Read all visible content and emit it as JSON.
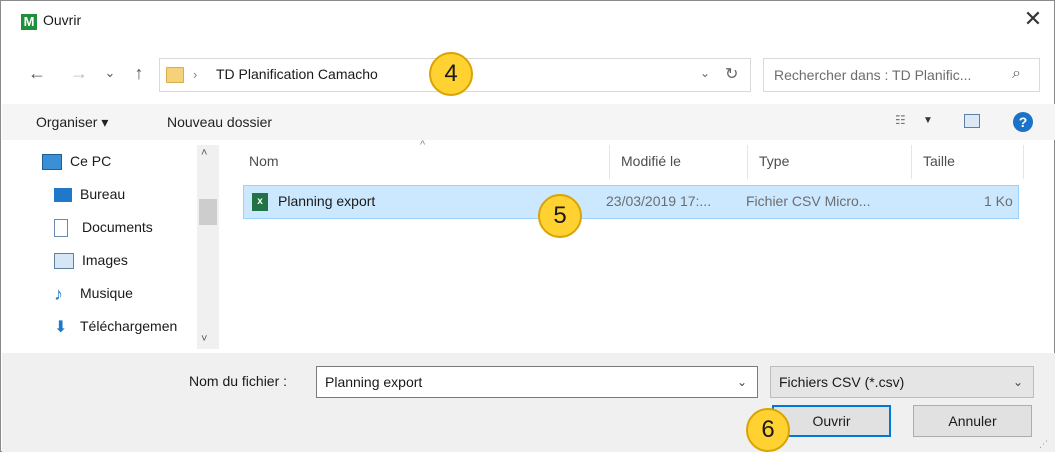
{
  "window": {
    "title": "Ouvrir",
    "app_icon_letter": "M",
    "close_glyph": "✕"
  },
  "nav": {
    "back": "←",
    "forward": "→",
    "recent": "⌄",
    "up": "↑"
  },
  "address": {
    "separator": "›",
    "path": "TD Planification Camacho",
    "dropdown": "⌄",
    "refresh": "↻"
  },
  "search": {
    "placeholder": "Rechercher dans : TD Planific...",
    "icon": "⌕"
  },
  "toolbar": {
    "organize": "Organiser ▾",
    "new_folder": "Nouveau dossier",
    "view_icon": "☷",
    "view_dropdown": "▼",
    "help": "?"
  },
  "sidebar": {
    "items": [
      {
        "label": "Ce PC",
        "icon": "pc-icon"
      },
      {
        "label": "Bureau",
        "icon": "desktop-icon"
      },
      {
        "label": "Documents",
        "icon": "documents-icon"
      },
      {
        "label": "Images",
        "icon": "images-icon"
      },
      {
        "label": "Musique",
        "icon": "music-icon"
      },
      {
        "label": "Téléchargemen",
        "icon": "download-icon"
      }
    ],
    "scroll_up": "˄",
    "scroll_down": "˅"
  },
  "columns": {
    "name": "Nom",
    "modified": "Modifié le",
    "type": "Type",
    "size": "Taille",
    "sort": "^"
  },
  "files": [
    {
      "name": "Planning export",
      "modified": "23/03/2019 17:...",
      "type": "Fichier CSV Micro...",
      "size": "1 Ko",
      "icon_letter": "x"
    }
  ],
  "footer": {
    "filename_label": "Nom du fichier :",
    "filename_value": "Planning export",
    "filename_dropdown": "⌄",
    "filter_value": "Fichiers CSV (*.csv)",
    "filter_dropdown": "⌄",
    "open_label": "Ouvrir",
    "cancel_label": "Annuler",
    "grip": "⋰"
  },
  "markers": [
    "4",
    "5",
    "6"
  ],
  "colors": {
    "selection": "#cce8ff",
    "selection_border": "#99d1ff",
    "accent": "#0078d7",
    "marker": "#ffd232"
  }
}
